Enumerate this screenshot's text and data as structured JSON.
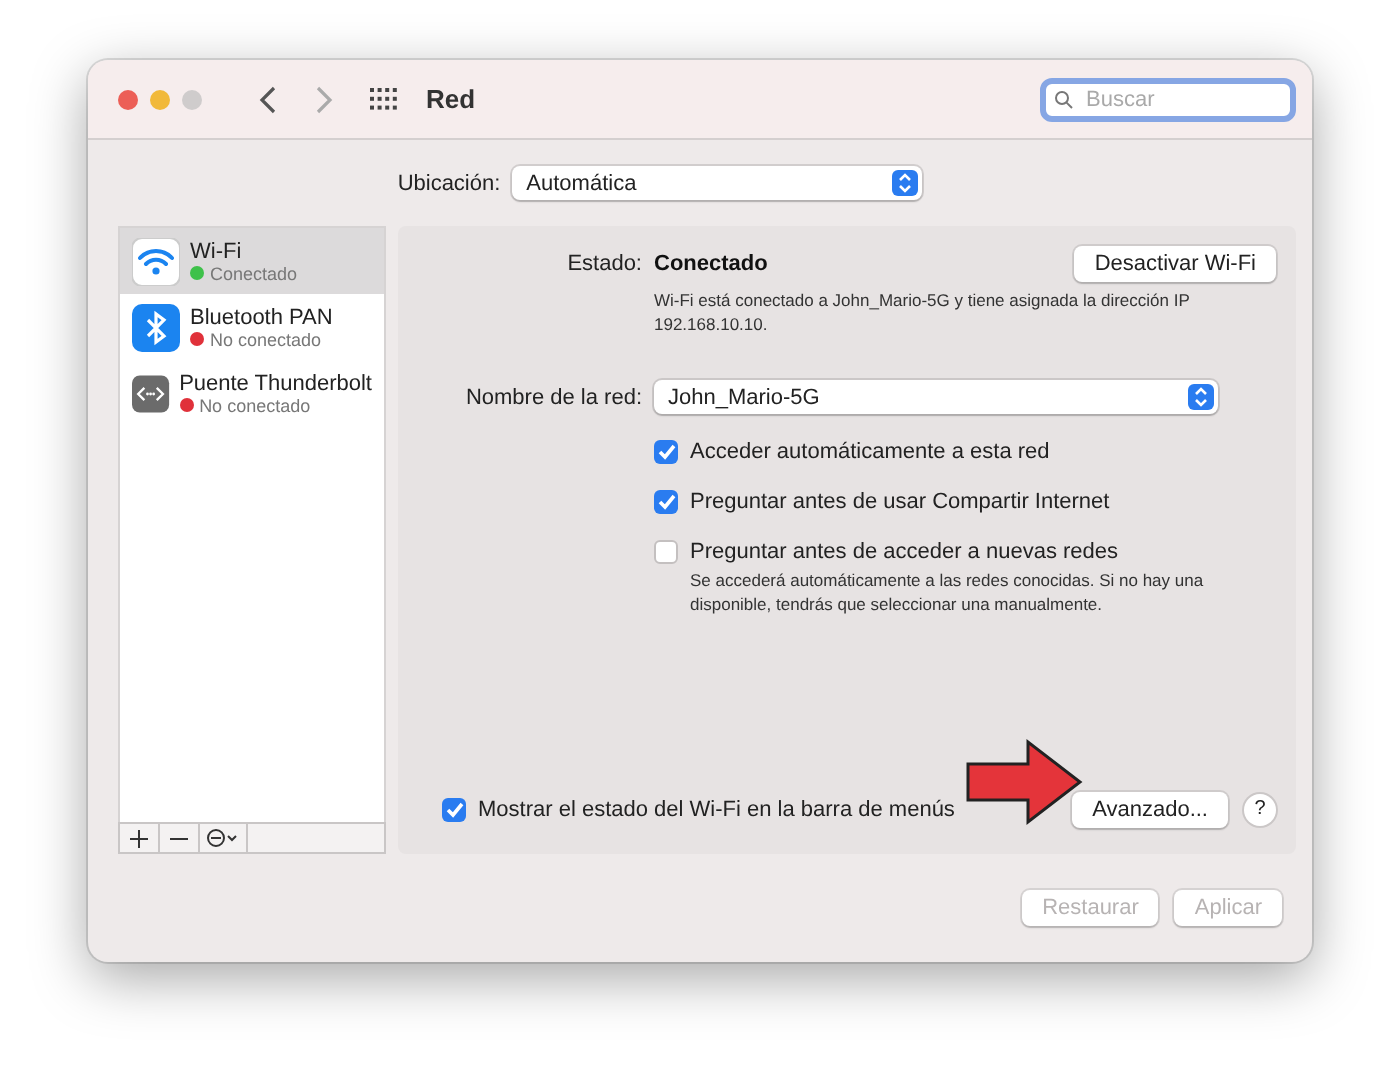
{
  "window": {
    "title": "Red"
  },
  "search": {
    "placeholder": "Buscar"
  },
  "location": {
    "label": "Ubicación:",
    "value": "Automática"
  },
  "services": [
    {
      "name": "Wi-Fi",
      "status": "Conectado",
      "color": "#3ec14a",
      "kind": "wifi",
      "selected": true
    },
    {
      "name": "Bluetooth PAN",
      "status": "No conectado",
      "color": "#e0313a",
      "kind": "bluetooth",
      "selected": false
    },
    {
      "name": "Puente Thunderbolt",
      "status": "No conectado",
      "color": "#e0313a",
      "kind": "bridge",
      "selected": false
    }
  ],
  "detail": {
    "status_label": "Estado:",
    "status_value": "Conectado",
    "toggle_button": "Desactivar Wi-Fi",
    "status_description": "Wi-Fi está conectado a John_Mario-5G y tiene asignada la dirección IP 192.168.10.10.",
    "network_label": "Nombre de la red:",
    "network_value": "John_Mario-5G",
    "options": [
      {
        "label": "Acceder automáticamente a esta red",
        "checked": true
      },
      {
        "label": "Preguntar antes de usar Compartir Internet",
        "checked": true
      },
      {
        "label": "Preguntar antes de acceder a nuevas redes",
        "checked": false
      }
    ],
    "options_note": "Se accederá automáticamente a las redes conocidas. Si no hay una disponible, tendrás que seleccionar una manualmente.",
    "menu_bar_option": {
      "label": "Mostrar el estado del Wi-Fi en la barra de menús",
      "checked": true
    },
    "advanced_button": "Avanzado...",
    "help_button": "?"
  },
  "footer": {
    "buttons": [
      {
        "label": "Restaurar",
        "disabled": true
      },
      {
        "label": "Aplicar",
        "disabled": true
      }
    ]
  }
}
